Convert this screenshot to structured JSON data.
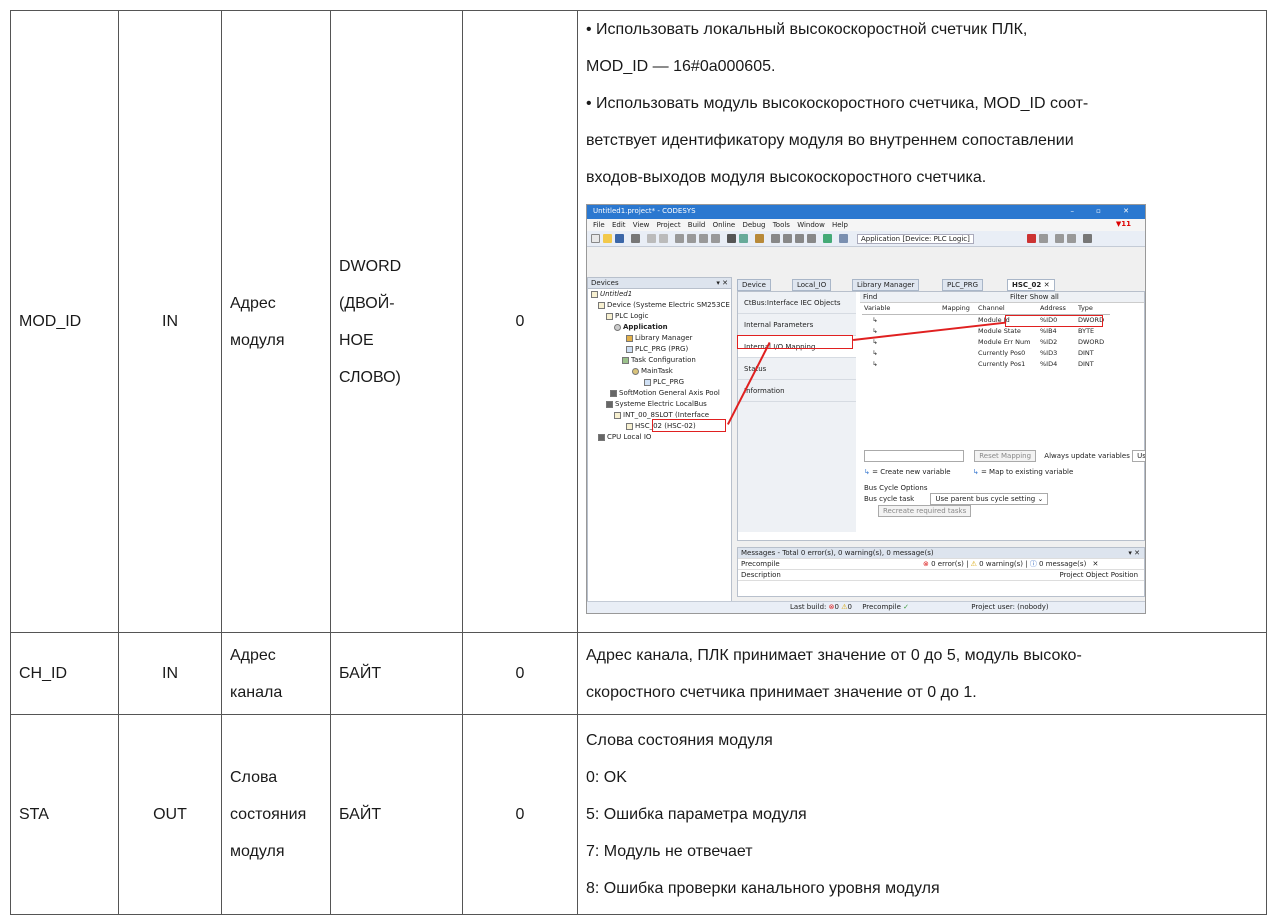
{
  "rows": {
    "mod_id": {
      "name": "MOD_ID",
      "dir": "IN",
      "desc": [
        "Адрес",
        "модуля"
      ],
      "type": [
        "DWORD",
        "(ДВОЙ-",
        "НОЕ",
        "СЛОВО)"
      ],
      "init": "0",
      "note": [
        "• Использовать локальный высокоскоростной счетчик ПЛК,",
        "MOD_ID — 16#0a000605.",
        "• Использовать модуль высокоскоростного счетчика, MOD_ID соот-",
        "ветствует идентификатору модуля во внутреннем сопоставлении",
        "входов-выходов модуля высокоскоростного счетчика."
      ]
    },
    "ch_id": {
      "name": "CH_ID",
      "dir": "IN",
      "desc": [
        "Адрес",
        "канала"
      ],
      "type": "БАЙТ",
      "init": "0",
      "note": [
        "Адрес канала, ПЛК принимает значение от 0 до 5, модуль высоко-",
        "скоростного счетчика принимает значение от 0 до 1."
      ]
    },
    "sta": {
      "name": "STA",
      "dir": "OUT",
      "desc": [
        "Слова",
        "состояния",
        "модуля"
      ],
      "type": "БАЙТ",
      "init": "0",
      "note": [
        "Слова состояния модуля",
        "0: OK",
        "5: Ошибка параметра модуля",
        "7: Модуль не отвечает",
        "8: Ошибка проверки канального уровня модуля"
      ]
    }
  },
  "screenshot": {
    "title": "Untitled1.project* - CODESYS",
    "menu": [
      "File",
      "Edit",
      "View",
      "Project",
      "Build",
      "Online",
      "Debug",
      "Tools",
      "Window",
      "Help"
    ],
    "alarm_count": "11",
    "app_selector": "Application [Device: PLC Logic]",
    "devices_header": "Devices",
    "tree": [
      "Untitled1",
      "Device (Systeme Electric SM253CE",
      "PLC Logic",
      "Application",
      "Library Manager",
      "PLC_PRG (PRG)",
      "Task Configuration",
      "MainTask",
      "PLC_PRG",
      "SoftMotion General Axis Pool",
      "Systeme Electric LocalBus",
      "INT_00_8SLOT (Interface",
      "HSC_02 (HSC-02)",
      "CPU Local IO"
    ],
    "tabs": [
      "Device",
      "Local_IO",
      "Library Manager",
      "PLC_PRG",
      "HSC_02"
    ],
    "vtabs": [
      "CtBus:Interface IEC Objects",
      "Internal Parameters",
      "Internal I/O Mapping",
      "Status",
      "Information"
    ],
    "find": "Find",
    "filter": "Filter",
    "show_all": "Show all",
    "columns": [
      "Variable",
      "Mapping",
      "Channel",
      "Address",
      "Type"
    ],
    "mapping": [
      [
        "Module Id",
        "%ID0",
        "DWORD"
      ],
      [
        "Module State",
        "%IB4",
        "BYTE"
      ],
      [
        "Module Err Num",
        "%ID2",
        "DWORD"
      ],
      [
        "Currently Pos0",
        "%ID3",
        "DINT"
      ],
      [
        "Currently Pos1",
        "%ID4",
        "DINT"
      ]
    ],
    "reset_mapping": "Reset Mapping",
    "always_update": "Always update variables",
    "use_par": "Use par",
    "legend_new": "= Create new variable",
    "legend_map": "= Map to existing variable",
    "bus_cycle_options": "Bus Cycle Options",
    "bus_cycle_task": "Bus cycle task",
    "bus_cycle_value": "Use parent bus cycle setting",
    "recreate": "Recreate required tasks",
    "messages_header": "Messages - Total 0 error(s), 0 warning(s), 0 message(s)",
    "precompile": "Precompile",
    "msg_errors": "0 error(s)",
    "msg_warnings": "0 warning(s)",
    "msg_messages": "0 message(s)",
    "description": "Description",
    "msg_cols": "Project  Object  Position",
    "last_build": "Last build:",
    "lb_err": "0",
    "lb_warn": "0",
    "status_precompile": "Precompile",
    "project_user": "Project user: (nobody)"
  }
}
